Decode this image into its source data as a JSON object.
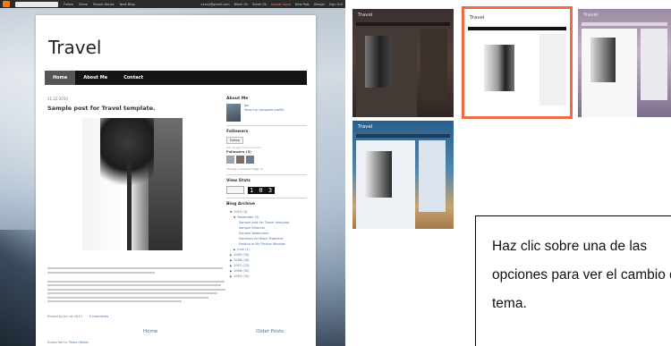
{
  "preview": {
    "navbar": {
      "items": [
        "Follow",
        "Share",
        "Report Abuse",
        "Next Blog"
      ],
      "right_items": [
        "xxxxx@gmail.com",
        "Blank Ok",
        "Blank Ok",
        "Import Local",
        "New Post",
        "Design",
        "Sign Out"
      ]
    },
    "blog_title": "Travel",
    "menu": [
      "Home",
      "About Me",
      "Contact"
    ],
    "post": {
      "date": "11.22.2010",
      "title": "Sample post for Travel template.",
      "posted_by": "Posted by Jon at 06:07",
      "comments": "0 comments"
    },
    "pager": {
      "home": "Home",
      "older": "Older Posts"
    },
    "subscribe": {
      "label": "Subscribe to:",
      "link": "Posts (Atom)"
    },
    "sidebar": {
      "about_heading": "About Me",
      "about_name": "Jon",
      "about_link": "View my complete profile",
      "followers_heading": "Followers",
      "follow_button": "Follow",
      "follow_sub": "with Google Friend Connect",
      "followers_count": "Followers (3)",
      "already_member": "Already a member?",
      "sign_in": "Sign in",
      "stats_heading": "View Stats",
      "stats_value": "1 0 3",
      "archive_heading": "Blog Archive",
      "archive": [
        {
          "text": "2010 (4)",
          "level": 1
        },
        {
          "text": "November (3)",
          "level": 2
        },
        {
          "text": "Sample post for Travel template.",
          "level": 3
        },
        {
          "text": "Sample Ethereal",
          "level": 3
        },
        {
          "text": "Sample Watermark",
          "level": 3
        },
        {
          "text": "Solutions for Basic Problems",
          "level": 3
        },
        {
          "text": "Posting to My Picture Window",
          "level": 3
        },
        {
          "text": "June (1)",
          "level": 2
        },
        {
          "text": "2009 (16)",
          "level": 1
        },
        {
          "text": "2008 (18)",
          "level": 1
        },
        {
          "text": "2007 (23)",
          "level": 1
        },
        {
          "text": "2006 (32)",
          "level": 1
        },
        {
          "text": "2005 (33)",
          "level": 1
        }
      ]
    }
  },
  "themes": [
    {
      "title": "Travel",
      "selected": false,
      "accent": "#52403a"
    },
    {
      "title": "Travel",
      "selected": true,
      "accent": "#ee6a45"
    },
    {
      "title": "Travel",
      "selected": false,
      "accent": "#9d8ba5"
    },
    {
      "title": "Travel",
      "selected": false,
      "accent": "#2a5e8c"
    }
  ],
  "callout": {
    "line1": "Haz clic sobre una de las",
    "line2": "opciones para ver el cambio de",
    "line3": "tema."
  }
}
